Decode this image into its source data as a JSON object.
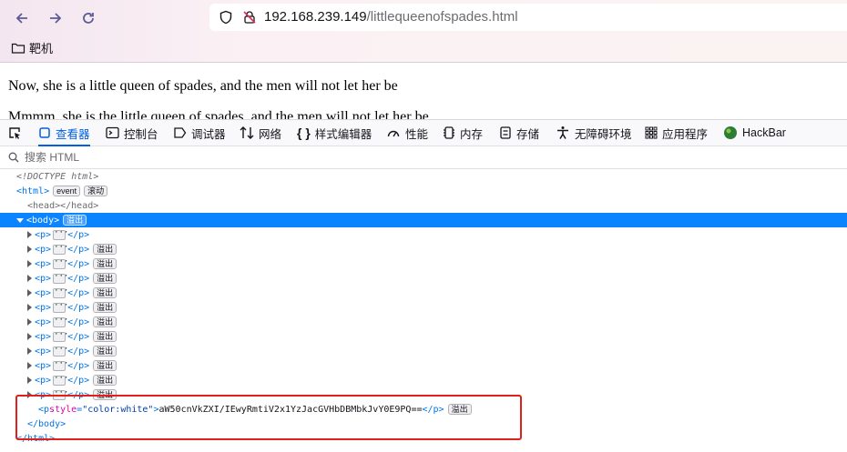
{
  "browser": {
    "url_host": "192.168.239.149",
    "url_path": "/littlequeenofspades.html",
    "bookmark_label": "靶机",
    "icons": {
      "back": "arrow-left-icon",
      "forward": "arrow-right-icon",
      "reload": "reload-icon",
      "shield": "shield-icon",
      "insecure": "insecure-lock-icon",
      "folder": "folder-icon"
    }
  },
  "page": {
    "lines": [
      "Now, she is a little queen of spades, and the men will not let her be",
      "Mmmm, she is the little queen of spades, and the men will not let her be"
    ]
  },
  "devtools": {
    "tabs": [
      {
        "label": "查看器",
        "icon": "inspector-icon",
        "active": true
      },
      {
        "label": "控制台",
        "icon": "console-icon"
      },
      {
        "label": "调试器",
        "icon": "debugger-icon"
      },
      {
        "label": "网络",
        "icon": "network-icon"
      },
      {
        "label": "样式编辑器",
        "icon": "style-editor-icon"
      },
      {
        "label": "性能",
        "icon": "performance-icon"
      },
      {
        "label": "内存",
        "icon": "memory-icon"
      },
      {
        "label": "存储",
        "icon": "storage-icon"
      },
      {
        "label": "无障碍环境",
        "icon": "accessibility-icon"
      },
      {
        "label": "应用程序",
        "icon": "application-icon"
      },
      {
        "label": "HackBar",
        "icon": "hackbar-icon"
      }
    ],
    "search_placeholder": "搜索 HTML",
    "tree": {
      "doctype": "<!DOCTYPE html>",
      "html_open": "<html>",
      "html_close": "</html>",
      "badge_event": "event",
      "badge_scroll": "滚动",
      "badge_overflow": "溢出",
      "head": "<head></head>",
      "body_open": "<body>",
      "body_close": "</body>",
      "p_open": "<p>",
      "p_close": "</p>",
      "collapsed_p_count": 12,
      "last_p_tag_open": "<p ",
      "last_p_attr_name": "style",
      "last_p_attr_eq": "=",
      "last_p_attr_value": "\"color:white\"",
      "last_p_tag_gt": ">",
      "last_p_text": "aW50cnVkZXI/IEwyRmtiV2x1YzJacGVHbDBMbkJvY0E9PQ==",
      "last_p_close": "</p>"
    }
  }
}
